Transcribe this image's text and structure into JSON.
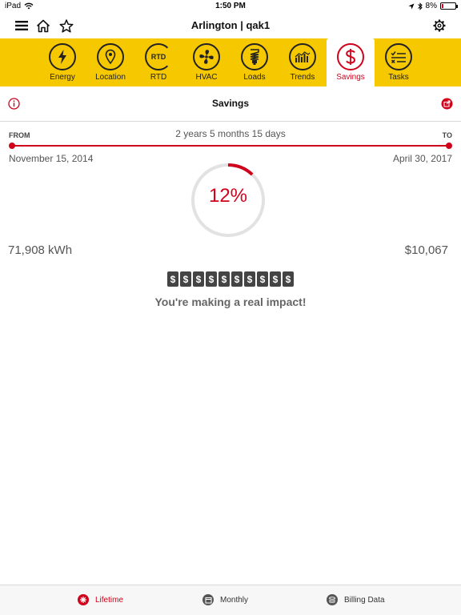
{
  "status_bar": {
    "device": "iPad",
    "time": "1:50 PM",
    "battery": "8%"
  },
  "header": {
    "title": "Arlington | qak1"
  },
  "nav": {
    "items": [
      {
        "label": "Energy",
        "icon": "lightning-icon"
      },
      {
        "label": "Location",
        "icon": "location-pin-icon"
      },
      {
        "label": "RTD",
        "icon": "rtd-icon",
        "icon_text": "RTD"
      },
      {
        "label": "HVAC",
        "icon": "fan-icon"
      },
      {
        "label": "Loads",
        "icon": "bulb-icon"
      },
      {
        "label": "Trends",
        "icon": "bar-chart-icon"
      },
      {
        "label": "Savings",
        "icon": "dollar-icon",
        "active": true
      },
      {
        "label": "Tasks",
        "icon": "checklist-icon"
      }
    ]
  },
  "savings": {
    "title": "Savings",
    "from_label": "FROM",
    "to_label": "TO",
    "duration": "2 years 5 months 15 days",
    "from_date": "November 15, 2014",
    "to_date": "April 30, 2017",
    "percent": 12,
    "percent_text": "12%",
    "kwh": "71,908 kWh",
    "dollars": "$10,067",
    "counter": [
      "$",
      "$",
      "$",
      "$",
      "$",
      "$",
      "$",
      "$",
      "$",
      "$"
    ],
    "message": "You're making a real impact!"
  },
  "tabs": {
    "lifetime": "Lifetime",
    "monthly": "Monthly",
    "billing": "Billing Data"
  },
  "colors": {
    "accent": "#d0021b",
    "nav_bg": "#f5c800"
  }
}
